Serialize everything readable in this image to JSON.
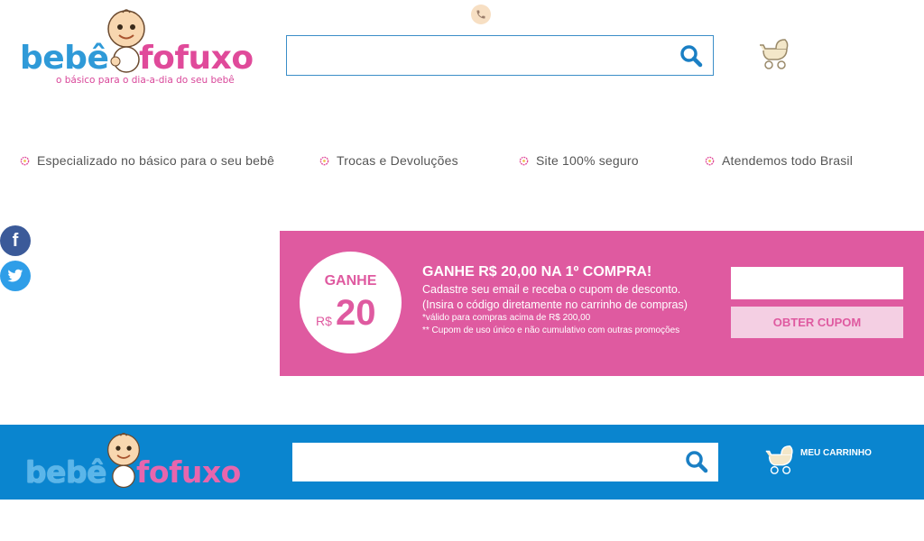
{
  "brand": {
    "name_part1": "bebê",
    "name_part2": "fofuxo",
    "tagline": "o básico para o dia-a-dia do seu bebê"
  },
  "header": {
    "search": {
      "placeholder": "",
      "value": ""
    }
  },
  "features": [
    {
      "label": "Especializado no básico para o seu bebê"
    },
    {
      "label": "Trocas e Devoluções"
    },
    {
      "label": "Site 100% seguro"
    },
    {
      "label": "Atendemos todo Brasil"
    }
  ],
  "social": {
    "facebook": "f"
  },
  "promo": {
    "circle_top": "GANHE",
    "circle_currency": "R$",
    "circle_amount": "20",
    "title": "GANHE R$ 20,00 NA 1º COMPRA!",
    "line1": "Cadastre seu email e receba o cupom de desconto.",
    "line2": "(Insira o código diretamente no carrinho de compras)",
    "line3": "*válido para compras acima de R$ 200,00",
    "line4": "** Cupom de uso único e não cumulativo com outras promoções",
    "email_value": "",
    "button_label": "OBTER CUPOM",
    "color": "#df5aa0"
  },
  "footer": {
    "search": {
      "placeholder": "",
      "value": ""
    },
    "cart_label": "MEU CARRINHO",
    "color": "#0a85cf"
  }
}
